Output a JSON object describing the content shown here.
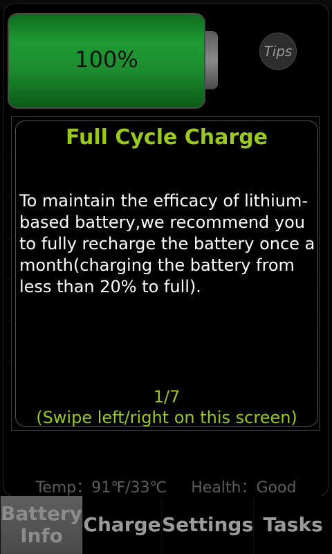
{
  "battery": {
    "level_text": "100%",
    "level_fraction": 1.0
  },
  "tips_button": {
    "label": "Tips"
  },
  "dialog": {
    "title": "Full Cycle Charge",
    "body": "To maintain the efficacy of lithium-based battery,we recommend you to fully recharge the battery once a month(charging the battery from less than 20% to full).",
    "page": "1/7",
    "hint": "(Swipe left/right on this screen)"
  },
  "footer": {
    "temp": "Temp：91℉/33℃",
    "health": "Health：Good"
  },
  "tabs": [
    {
      "label": "Battery\nInfo",
      "active": true
    },
    {
      "label": "Charge",
      "active": false
    },
    {
      "label": "Settings",
      "active": false
    },
    {
      "label": "Tasks",
      "active": false
    }
  ],
  "colors": {
    "accent": "#9ac81f",
    "battery_green": "#1f9a33"
  }
}
